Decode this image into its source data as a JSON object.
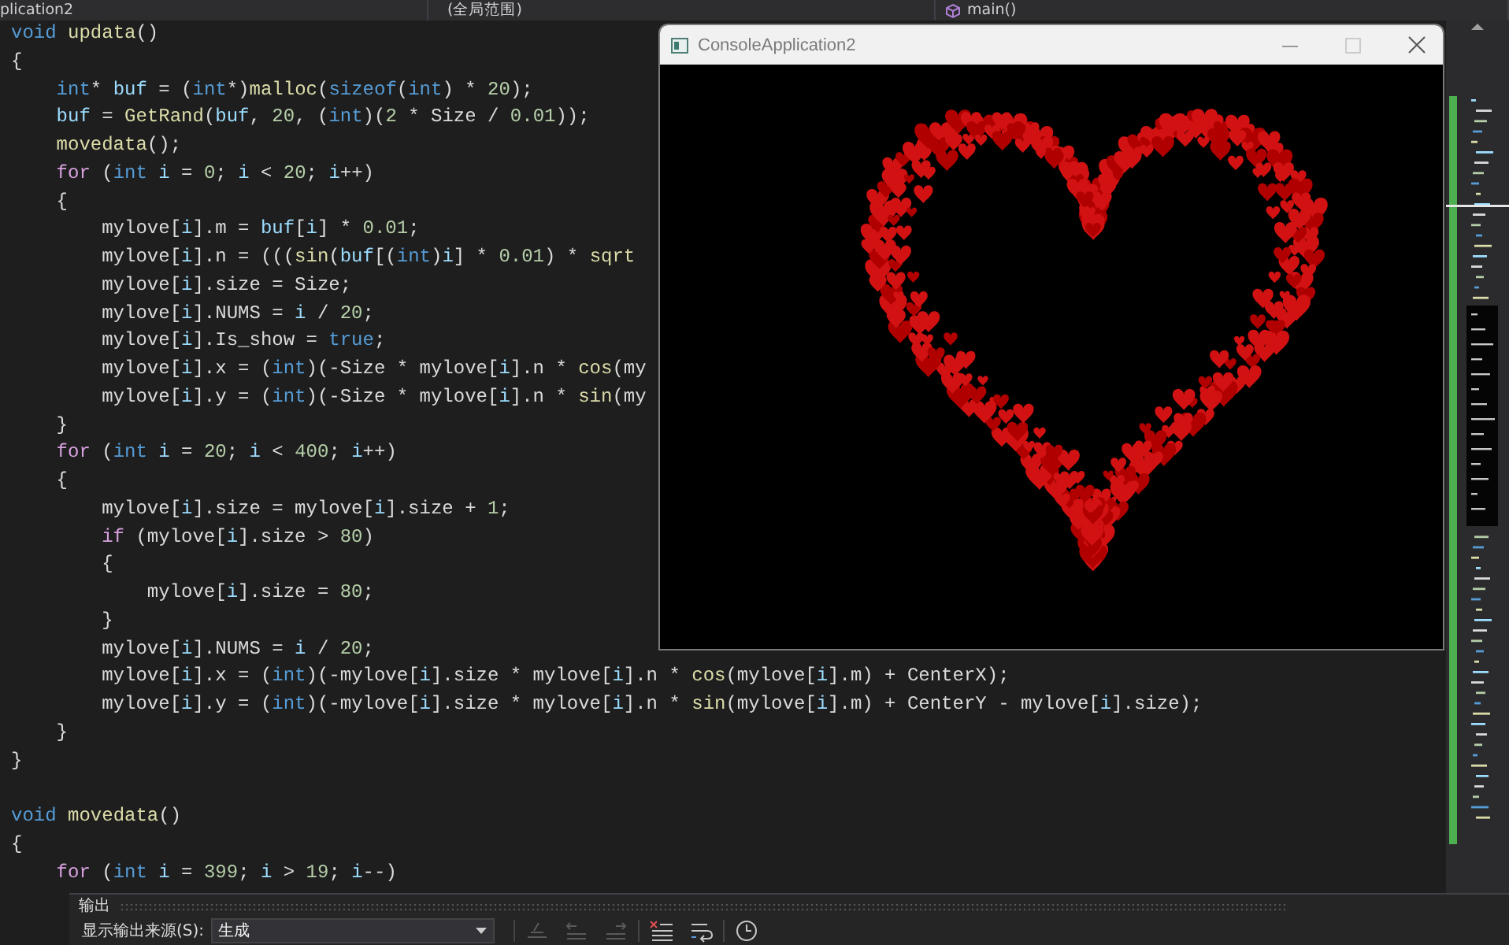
{
  "navigation_bar": {
    "project": "plication2",
    "scope": "(全局范围)",
    "function": "main()"
  },
  "code_lines": [
    {
      "kind": "code",
      "segments": [
        {
          "kind": "keyword",
          "text": "void"
        },
        {
          "kind": "function",
          "text": " updata"
        },
        {
          "kind": "plain",
          "text": "()"
        }
      ]
    },
    {
      "kind": "code",
      "segments": [
        {
          "kind": "plain",
          "text": "{"
        }
      ]
    },
    {
      "kind": "code",
      "segments": [
        {
          "kind": "keyword",
          "text": "    int"
        },
        {
          "kind": "plain",
          "text": "* "
        },
        {
          "kind": "variable",
          "text": "buf"
        },
        {
          "kind": "plain",
          "text": " = ("
        },
        {
          "kind": "keyword",
          "text": "int"
        },
        {
          "kind": "plain",
          "text": "*)"
        },
        {
          "kind": "function",
          "text": "malloc"
        },
        {
          "kind": "plain",
          "text": "("
        },
        {
          "kind": "keyword",
          "text": "sizeof"
        },
        {
          "kind": "plain",
          "text": "("
        },
        {
          "kind": "keyword",
          "text": "int"
        },
        {
          "kind": "plain",
          "text": ") * "
        },
        {
          "kind": "number",
          "text": "20"
        },
        {
          "kind": "plain",
          "text": ");"
        }
      ]
    },
    {
      "kind": "code",
      "segments": [
        {
          "kind": "variable",
          "text": "    buf"
        },
        {
          "kind": "plain",
          "text": " = "
        },
        {
          "kind": "function",
          "text": "GetRand"
        },
        {
          "kind": "plain",
          "text": "("
        },
        {
          "kind": "variable",
          "text": "buf"
        },
        {
          "kind": "plain",
          "text": ", "
        },
        {
          "kind": "number",
          "text": "20"
        },
        {
          "kind": "plain",
          "text": ", ("
        },
        {
          "kind": "keyword",
          "text": "int"
        },
        {
          "kind": "plain",
          "text": ")("
        },
        {
          "kind": "number",
          "text": "2"
        },
        {
          "kind": "plain",
          "text": " * Size / "
        },
        {
          "kind": "number",
          "text": "0.01"
        },
        {
          "kind": "plain",
          "text": "));"
        }
      ]
    },
    {
      "kind": "code",
      "segments": [
        {
          "kind": "function",
          "text": "    movedata"
        },
        {
          "kind": "plain",
          "text": "();"
        }
      ]
    },
    {
      "kind": "code",
      "segments": [
        {
          "kind": "control",
          "text": "    for"
        },
        {
          "kind": "plain",
          "text": " ("
        },
        {
          "kind": "keyword",
          "text": "int"
        },
        {
          "kind": "variable",
          "text": " i"
        },
        {
          "kind": "plain",
          "text": " = "
        },
        {
          "kind": "number",
          "text": "0"
        },
        {
          "kind": "plain",
          "text": "; "
        },
        {
          "kind": "variable",
          "text": "i"
        },
        {
          "kind": "plain",
          "text": " < "
        },
        {
          "kind": "number",
          "text": "20"
        },
        {
          "kind": "plain",
          "text": "; "
        },
        {
          "kind": "variable",
          "text": "i"
        },
        {
          "kind": "plain",
          "text": "++)"
        }
      ]
    },
    {
      "kind": "code",
      "segments": [
        {
          "kind": "plain",
          "text": "    {"
        }
      ]
    },
    {
      "kind": "code",
      "segments": [
        {
          "kind": "plain",
          "text": "        mylove["
        },
        {
          "kind": "variable",
          "text": "i"
        },
        {
          "kind": "plain",
          "text": "].m = "
        },
        {
          "kind": "variable",
          "text": "buf"
        },
        {
          "kind": "plain",
          "text": "["
        },
        {
          "kind": "variable",
          "text": "i"
        },
        {
          "kind": "plain",
          "text": "] * "
        },
        {
          "kind": "number",
          "text": "0.01"
        },
        {
          "kind": "plain",
          "text": ";"
        }
      ]
    },
    {
      "kind": "code",
      "segments": [
        {
          "kind": "plain",
          "text": "        mylove["
        },
        {
          "kind": "variable",
          "text": "i"
        },
        {
          "kind": "plain",
          "text": "].n = ((("
        },
        {
          "kind": "function",
          "text": "sin"
        },
        {
          "kind": "plain",
          "text": "("
        },
        {
          "kind": "variable",
          "text": "buf"
        },
        {
          "kind": "plain",
          "text": "[("
        },
        {
          "kind": "keyword",
          "text": "int"
        },
        {
          "kind": "plain",
          "text": ")"
        },
        {
          "kind": "variable",
          "text": "i"
        },
        {
          "kind": "plain",
          "text": "] * "
        },
        {
          "kind": "number",
          "text": "0.01"
        },
        {
          "kind": "plain",
          "text": ") * "
        },
        {
          "kind": "function",
          "text": "sqrt"
        }
      ]
    },
    {
      "kind": "code",
      "segments": [
        {
          "kind": "plain",
          "text": "        mylove["
        },
        {
          "kind": "variable",
          "text": "i"
        },
        {
          "kind": "plain",
          "text": "].size = Size;"
        }
      ]
    },
    {
      "kind": "code",
      "segments": [
        {
          "kind": "plain",
          "text": "        mylove["
        },
        {
          "kind": "variable",
          "text": "i"
        },
        {
          "kind": "plain",
          "text": "].NUMS = "
        },
        {
          "kind": "variable",
          "text": "i"
        },
        {
          "kind": "plain",
          "text": " / "
        },
        {
          "kind": "number",
          "text": "20"
        },
        {
          "kind": "plain",
          "text": ";"
        }
      ]
    },
    {
      "kind": "code",
      "segments": [
        {
          "kind": "plain",
          "text": "        mylove["
        },
        {
          "kind": "variable",
          "text": "i"
        },
        {
          "kind": "plain",
          "text": "].Is_show = "
        },
        {
          "kind": "keyword",
          "text": "true"
        },
        {
          "kind": "plain",
          "text": ";"
        }
      ]
    },
    {
      "kind": "code",
      "segments": [
        {
          "kind": "plain",
          "text": "        mylove["
        },
        {
          "kind": "variable",
          "text": "i"
        },
        {
          "kind": "plain",
          "text": "].x = ("
        },
        {
          "kind": "keyword",
          "text": "int"
        },
        {
          "kind": "plain",
          "text": ")(-Size * mylove["
        },
        {
          "kind": "variable",
          "text": "i"
        },
        {
          "kind": "plain",
          "text": "].n * "
        },
        {
          "kind": "function",
          "text": "cos"
        },
        {
          "kind": "plain",
          "text": "(my"
        }
      ]
    },
    {
      "kind": "code",
      "segments": [
        {
          "kind": "plain",
          "text": "        mylove["
        },
        {
          "kind": "variable",
          "text": "i"
        },
        {
          "kind": "plain",
          "text": "].y = ("
        },
        {
          "kind": "keyword",
          "text": "int"
        },
        {
          "kind": "plain",
          "text": ")(-Size * mylove["
        },
        {
          "kind": "variable",
          "text": "i"
        },
        {
          "kind": "plain",
          "text": "].n * "
        },
        {
          "kind": "function",
          "text": "sin"
        },
        {
          "kind": "plain",
          "text": "(my"
        }
      ]
    },
    {
      "kind": "code",
      "segments": [
        {
          "kind": "plain",
          "text": "    }"
        }
      ]
    },
    {
      "kind": "code",
      "segments": [
        {
          "kind": "control",
          "text": "    for"
        },
        {
          "kind": "plain",
          "text": " ("
        },
        {
          "kind": "keyword",
          "text": "int"
        },
        {
          "kind": "variable",
          "text": " i"
        },
        {
          "kind": "plain",
          "text": " = "
        },
        {
          "kind": "number",
          "text": "20"
        },
        {
          "kind": "plain",
          "text": "; "
        },
        {
          "kind": "variable",
          "text": "i"
        },
        {
          "kind": "plain",
          "text": " < "
        },
        {
          "kind": "number",
          "text": "400"
        },
        {
          "kind": "plain",
          "text": "; "
        },
        {
          "kind": "variable",
          "text": "i"
        },
        {
          "kind": "plain",
          "text": "++)"
        }
      ]
    },
    {
      "kind": "code",
      "segments": [
        {
          "kind": "plain",
          "text": "    {"
        }
      ]
    },
    {
      "kind": "code",
      "segments": [
        {
          "kind": "plain",
          "text": "        mylove["
        },
        {
          "kind": "variable",
          "text": "i"
        },
        {
          "kind": "plain",
          "text": "].size = mylove["
        },
        {
          "kind": "variable",
          "text": "i"
        },
        {
          "kind": "plain",
          "text": "].size + "
        },
        {
          "kind": "number",
          "text": "1"
        },
        {
          "kind": "plain",
          "text": ";"
        }
      ]
    },
    {
      "kind": "code",
      "segments": [
        {
          "kind": "control",
          "text": "        if"
        },
        {
          "kind": "plain",
          "text": " (mylove["
        },
        {
          "kind": "variable",
          "text": "i"
        },
        {
          "kind": "plain",
          "text": "].size > "
        },
        {
          "kind": "number",
          "text": "80"
        },
        {
          "kind": "plain",
          "text": ")"
        }
      ]
    },
    {
      "kind": "code",
      "segments": [
        {
          "kind": "plain",
          "text": "        {"
        }
      ]
    },
    {
      "kind": "code",
      "segments": [
        {
          "kind": "plain",
          "text": "            mylove["
        },
        {
          "kind": "variable",
          "text": "i"
        },
        {
          "kind": "plain",
          "text": "].size = "
        },
        {
          "kind": "number",
          "text": "80"
        },
        {
          "kind": "plain",
          "text": ";"
        }
      ]
    },
    {
      "kind": "code",
      "segments": [
        {
          "kind": "plain",
          "text": "        }"
        }
      ]
    },
    {
      "kind": "code",
      "segments": [
        {
          "kind": "plain",
          "text": "        mylove["
        },
        {
          "kind": "variable",
          "text": "i"
        },
        {
          "kind": "plain",
          "text": "].NUMS = "
        },
        {
          "kind": "variable",
          "text": "i"
        },
        {
          "kind": "plain",
          "text": " / "
        },
        {
          "kind": "number",
          "text": "20"
        },
        {
          "kind": "plain",
          "text": ";"
        }
      ]
    },
    {
      "kind": "code",
      "segments": [
        {
          "kind": "plain",
          "text": "        mylove["
        },
        {
          "kind": "variable",
          "text": "i"
        },
        {
          "kind": "plain",
          "text": "].x = ("
        },
        {
          "kind": "keyword",
          "text": "int"
        },
        {
          "kind": "plain",
          "text": ")(-mylove["
        },
        {
          "kind": "variable",
          "text": "i"
        },
        {
          "kind": "plain",
          "text": "].size * mylove["
        },
        {
          "kind": "variable",
          "text": "i"
        },
        {
          "kind": "plain",
          "text": "].n * "
        },
        {
          "kind": "function",
          "text": "cos"
        },
        {
          "kind": "plain",
          "text": "(mylove["
        },
        {
          "kind": "variable",
          "text": "i"
        },
        {
          "kind": "plain",
          "text": "].m) + CenterX);"
        }
      ]
    },
    {
      "kind": "code",
      "segments": [
        {
          "kind": "plain",
          "text": "        mylove["
        },
        {
          "kind": "variable",
          "text": "i"
        },
        {
          "kind": "plain",
          "text": "].y = ("
        },
        {
          "kind": "keyword",
          "text": "int"
        },
        {
          "kind": "plain",
          "text": ")(-mylove["
        },
        {
          "kind": "variable",
          "text": "i"
        },
        {
          "kind": "plain",
          "text": "].size * mylove["
        },
        {
          "kind": "variable",
          "text": "i"
        },
        {
          "kind": "plain",
          "text": "].n * "
        },
        {
          "kind": "function",
          "text": "sin"
        },
        {
          "kind": "plain",
          "text": "(mylove["
        },
        {
          "kind": "variable",
          "text": "i"
        },
        {
          "kind": "plain",
          "text": "].m) + CenterY - mylove["
        },
        {
          "kind": "variable",
          "text": "i"
        },
        {
          "kind": "plain",
          "text": "].size);"
        }
      ]
    },
    {
      "kind": "code",
      "segments": [
        {
          "kind": "plain",
          "text": "    }"
        }
      ]
    },
    {
      "kind": "code",
      "segments": [
        {
          "kind": "plain",
          "text": "}"
        }
      ]
    },
    {
      "kind": "blank"
    },
    {
      "kind": "code",
      "segments": [
        {
          "kind": "keyword",
          "text": "void"
        },
        {
          "kind": "function",
          "text": " movedata"
        },
        {
          "kind": "plain",
          "text": "()"
        }
      ]
    },
    {
      "kind": "code",
      "segments": [
        {
          "kind": "plain",
          "text": "{"
        }
      ]
    },
    {
      "kind": "code",
      "segments": [
        {
          "kind": "control",
          "text": "    for"
        },
        {
          "kind": "plain",
          "text": " ("
        },
        {
          "kind": "keyword",
          "text": "int"
        },
        {
          "kind": "variable",
          "text": " i"
        },
        {
          "kind": "plain",
          "text": " = "
        },
        {
          "kind": "number",
          "text": "399"
        },
        {
          "kind": "plain",
          "text": "; "
        },
        {
          "kind": "variable",
          "text": "i"
        },
        {
          "kind": "plain",
          "text": " > "
        },
        {
          "kind": "number",
          "text": "19"
        },
        {
          "kind": "plain",
          "text": "; "
        },
        {
          "kind": "variable",
          "text": "i"
        },
        {
          "kind": "plain",
          "text": "--)"
        }
      ]
    }
  ],
  "console_window": {
    "title": "ConsoleApplication2"
  },
  "output_panel": {
    "title": "输出",
    "source_label": "显示输出来源(S):",
    "source": "生成",
    "tools": [
      {
        "kind": "find",
        "disabled": true
      },
      {
        "kind": "previous",
        "disabled": true
      },
      {
        "kind": "next",
        "disabled": true
      },
      {
        "kind": "clear",
        "disabled": false
      },
      {
        "kind": "wrap",
        "disabled": false
      },
      {
        "kind": "clock",
        "disabled": false
      }
    ]
  }
}
